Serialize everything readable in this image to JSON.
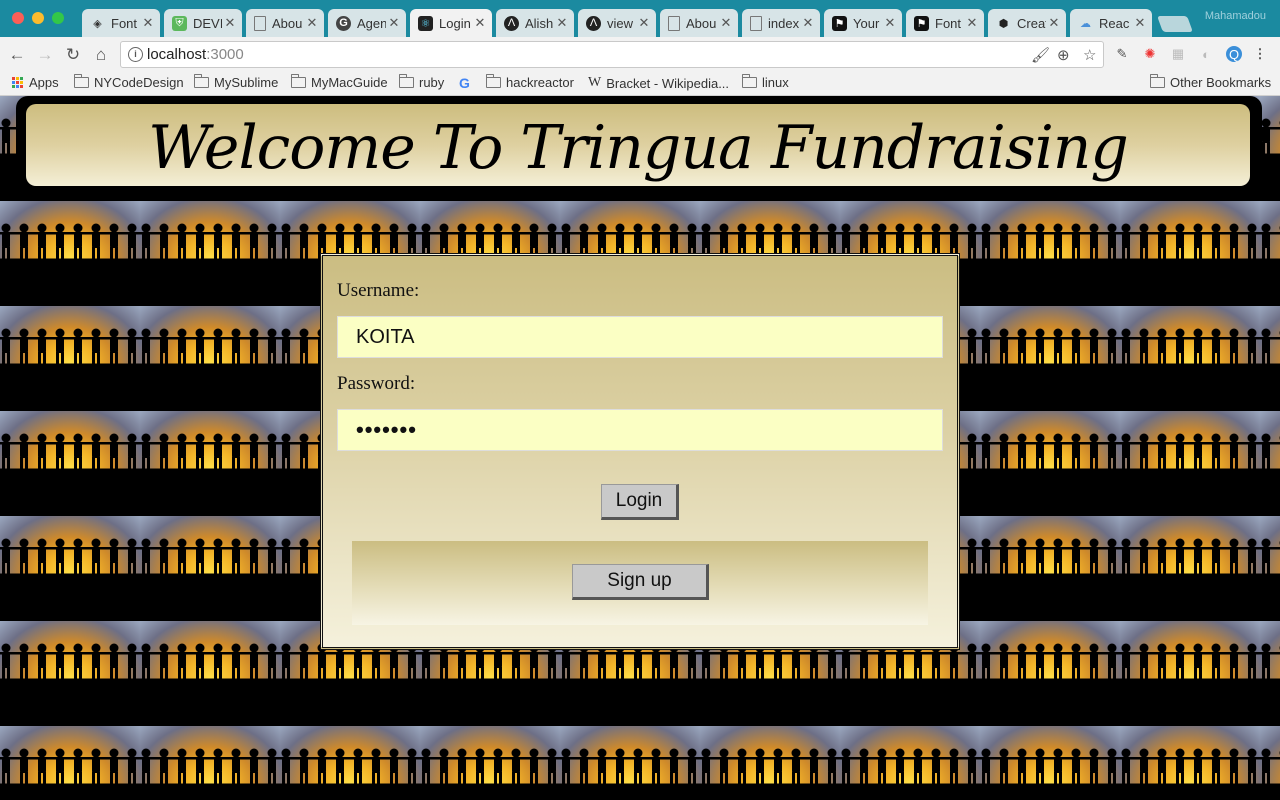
{
  "browser": {
    "tabs": [
      {
        "title": "Font",
        "icon": "diamond-icon",
        "active": false
      },
      {
        "title": "DEVI",
        "icon": "shield-icon",
        "active": false
      },
      {
        "title": "Abou",
        "icon": "page-icon",
        "active": false
      },
      {
        "title": "Agen",
        "icon": "g-logo-icon",
        "active": false
      },
      {
        "title": "Login",
        "icon": "react-icon",
        "active": true
      },
      {
        "title": "Alish",
        "icon": "triangle-logo-icon",
        "active": false
      },
      {
        "title": "view",
        "icon": "triangle-logo-icon",
        "active": false
      },
      {
        "title": "Abou",
        "icon": "page-icon",
        "active": false
      },
      {
        "title": "index",
        "icon": "page-icon",
        "active": false
      },
      {
        "title": "Your",
        "icon": "flag-icon",
        "active": false
      },
      {
        "title": "Font",
        "icon": "flag-icon",
        "active": false
      },
      {
        "title": "Creat",
        "icon": "cube-icon",
        "active": false
      },
      {
        "title": "Reac",
        "icon": "cloud-icon",
        "active": false
      }
    ],
    "profile_name": "Mahamadou",
    "url_host": "localhost",
    "url_port": ":3000",
    "bookmarks": [
      {
        "label": "Apps",
        "icon": "apps-grid-icon"
      },
      {
        "label": "NYCodeDesign",
        "icon": "folder-icon"
      },
      {
        "label": "MySublime",
        "icon": "folder-icon"
      },
      {
        "label": "MyMacGuide",
        "icon": "folder-icon"
      },
      {
        "label": "ruby",
        "icon": "folder-icon"
      },
      {
        "label": "",
        "icon": "google-icon"
      },
      {
        "label": "hackreactor",
        "icon": "folder-icon"
      },
      {
        "label": "Bracket - Wikipedia...",
        "icon": "wikipedia-icon"
      },
      {
        "label": "linux",
        "icon": "folder-icon"
      }
    ],
    "other_bookmarks": "Other Bookmarks"
  },
  "page": {
    "banner_title": "Welcome To Tringua Fundraising",
    "login": {
      "username_label": "Username:",
      "username_value": "KOITA",
      "password_label": "Password:",
      "password_value": "•••••••",
      "login_button": "Login",
      "signup_button": "Sign up"
    }
  }
}
